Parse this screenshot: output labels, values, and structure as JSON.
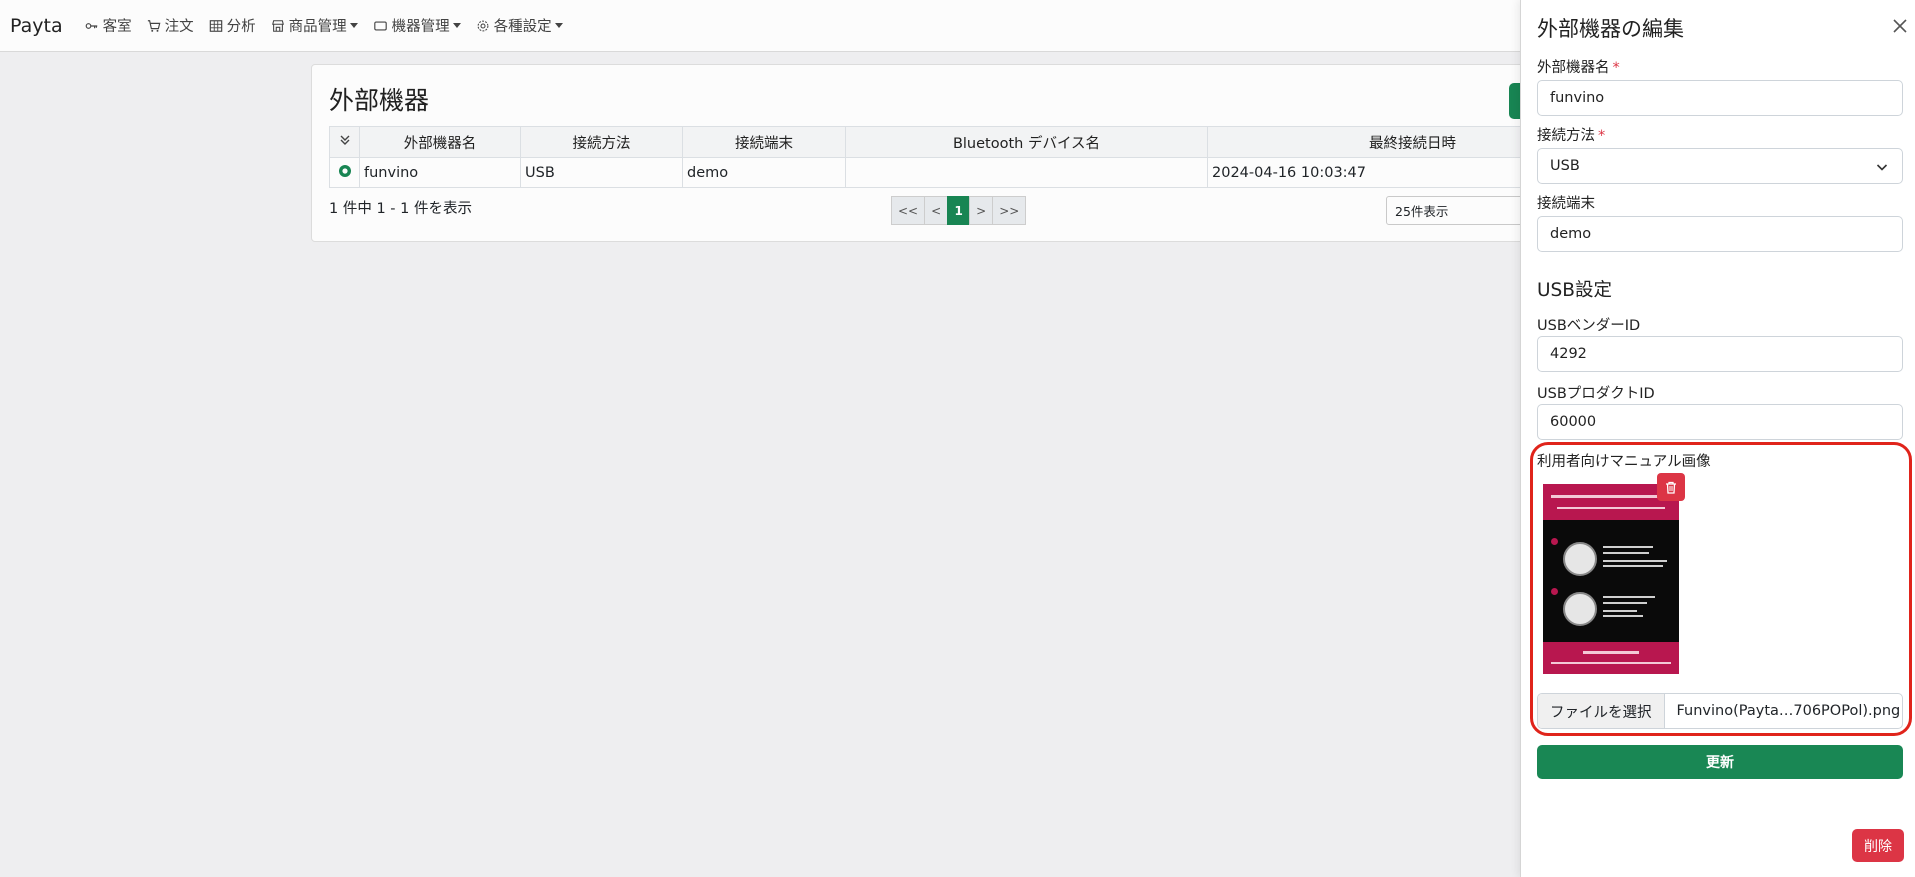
{
  "navbar": {
    "brand": "Payta",
    "items": [
      {
        "label": "客室",
        "icon": "key-icon",
        "dropdown": false
      },
      {
        "label": "注文",
        "icon": "cart-icon",
        "dropdown": false
      },
      {
        "label": "分析",
        "icon": "table-icon",
        "dropdown": false
      },
      {
        "label": "商品管理",
        "icon": "shop-icon",
        "dropdown": true
      },
      {
        "label": "機器管理",
        "icon": "device-icon",
        "dropdown": true
      },
      {
        "label": "各種設定",
        "icon": "gear-icon",
        "dropdown": true
      }
    ]
  },
  "main": {
    "title": "外部機器",
    "table": {
      "columns": [
        "外部機器名",
        "接続方法",
        "接続端末",
        "Bluetooth デバイス名",
        "最終接続日時"
      ],
      "rows": [
        {
          "name": "funvino",
          "method": "USB",
          "terminal": "demo",
          "bluetooth": "",
          "last_connected": "2024-04-16 10:03:47"
        }
      ]
    },
    "count_text": "1 件中 1 - 1 件を表示",
    "pagination": [
      "<<",
      "<",
      "1",
      ">",
      ">>"
    ],
    "active_page": "1",
    "per_page": "25件表示"
  },
  "panel": {
    "title": "外部機器の編集",
    "name_label": "外部機器名",
    "name_value": "funvino",
    "method_label": "接続方法",
    "method_value": "USB",
    "terminal_label": "接続端末",
    "terminal_value": "demo",
    "usb_section": "USB設定",
    "vendor_label": "USBベンダーID",
    "vendor_value": "4292",
    "product_label": "USBプロダクトID",
    "product_value": "60000",
    "manual_label": "利用者向けマニュアル画像",
    "file_button": "ファイルを選択",
    "file_name": "Funvino(Payta…706POPol).png",
    "update_button": "更新",
    "delete_button": "削除"
  },
  "colors": {
    "primary": "#198754",
    "danger": "#dc3545",
    "highlight": "#e0241b",
    "manual_accent": "#b8174f"
  }
}
